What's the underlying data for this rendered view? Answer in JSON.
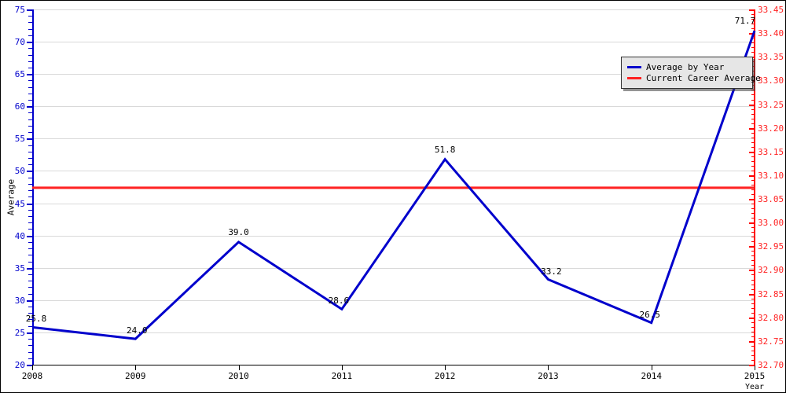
{
  "chart_data": {
    "type": "line",
    "title": "",
    "xlabel": "Year",
    "ylabel": "Average",
    "categories": [
      "2008",
      "2009",
      "2010",
      "2011",
      "2012",
      "2013",
      "2014",
      "2015"
    ],
    "x": [
      2008,
      2009,
      2010,
      2011,
      2012,
      2013,
      2014,
      2015
    ],
    "xlim": [
      2008,
      2015
    ],
    "ylim": [
      20,
      75
    ],
    "y2lim": [
      32.7,
      33.45
    ],
    "grid": "horizontal",
    "legend_position": "top-right",
    "series": [
      {
        "name": "Average by Year",
        "color": "#0000cc",
        "axis": "left",
        "values": [
          25.8,
          24.0,
          39.0,
          28.6,
          51.8,
          33.2,
          26.5,
          71.7
        ],
        "point_labels": [
          "25.8",
          "24.0",
          "39.0",
          "28.6",
          "51.8",
          "33.2",
          "26.5",
          "71.7"
        ]
      },
      {
        "name": "Current Career Average",
        "color": "#ff2222",
        "axis": "left",
        "type": "hline",
        "value": 47.4
      }
    ],
    "y_ticks_left": [
      "20",
      "25",
      "30",
      "35",
      "40",
      "45",
      "50",
      "55",
      "60",
      "65",
      "70",
      "75"
    ],
    "y_ticks_right": [
      "32.70",
      "32.75",
      "32.80",
      "32.85",
      "32.90",
      "32.95",
      "33.00",
      "33.05",
      "33.10",
      "33.15",
      "33.20",
      "33.25",
      "33.30",
      "33.35",
      "33.40",
      "33.45"
    ],
    "x_ticks": [
      "2008",
      "2009",
      "2010",
      "2011",
      "2012",
      "2013",
      "2014",
      "2015"
    ],
    "colors": {
      "left_axis": "#0000cc",
      "right_axis": "#ff2222",
      "grid": "#d9d9d9",
      "background": "#ffffff",
      "border": "#000000",
      "legend_bg": "#e6e6e6"
    }
  },
  "legend": {
    "items": [
      {
        "label": "Average by Year",
        "color": "#0000cc"
      },
      {
        "label": "Current Career Average",
        "color": "#ff2222"
      }
    ]
  },
  "axes": {
    "left_title": "Average",
    "bottom_title": "Year"
  }
}
